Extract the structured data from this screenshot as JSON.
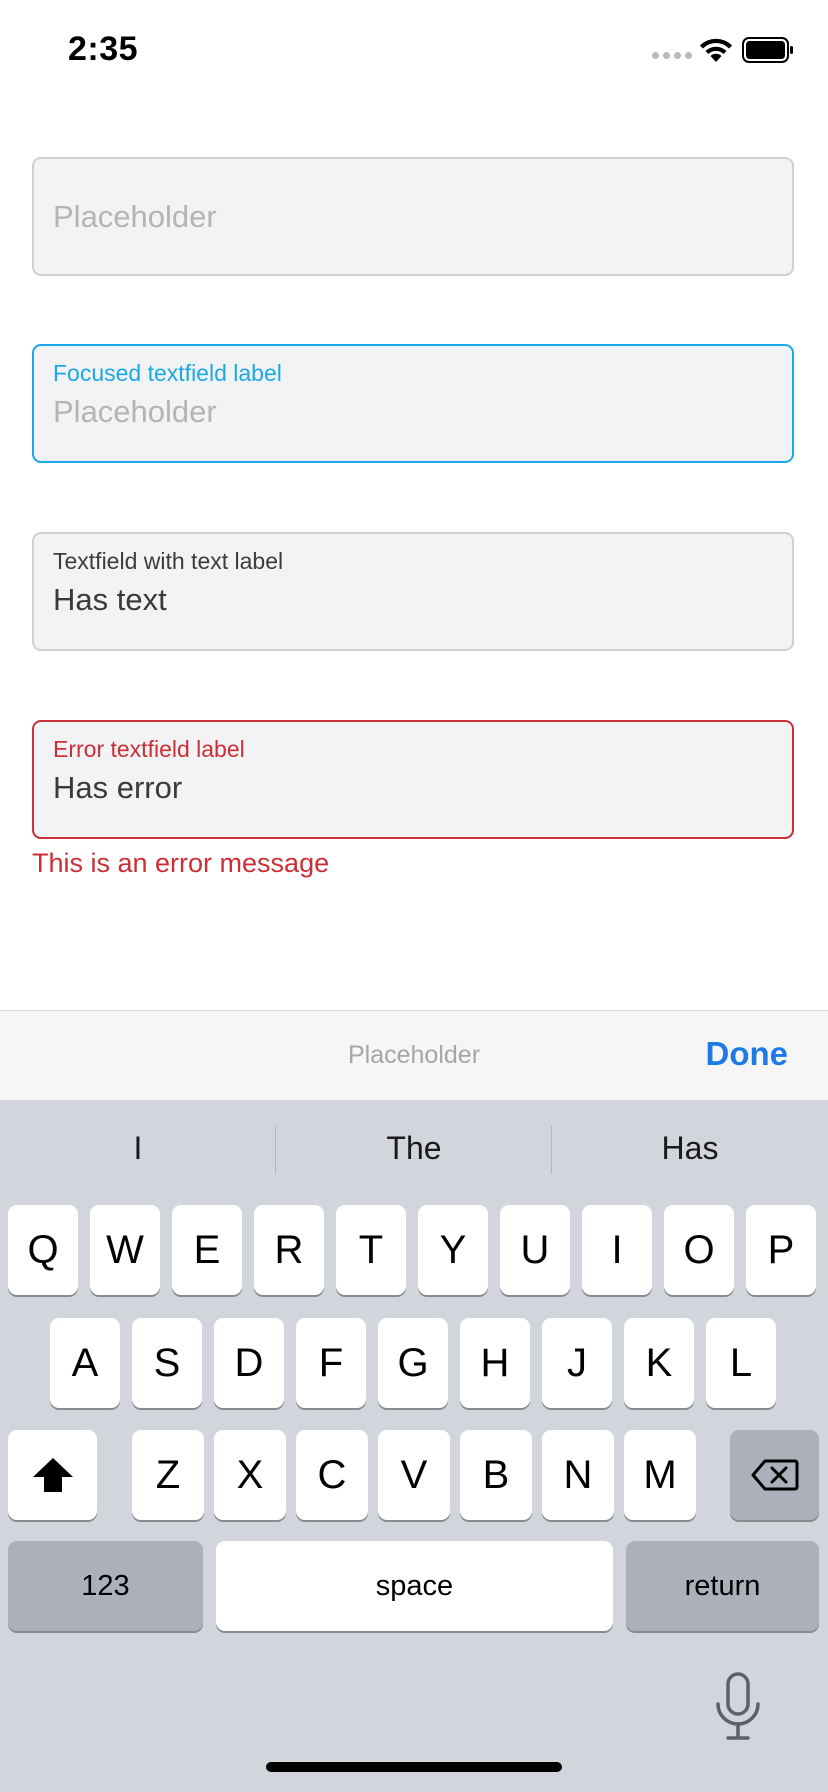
{
  "status_bar": {
    "time": "2:35"
  },
  "fields": [
    {
      "placeholder": "Placeholder"
    },
    {
      "label": "Focused textfield label",
      "placeholder": "Placeholder"
    },
    {
      "label": "Textfield with text label",
      "value": "Has text"
    },
    {
      "label": "Error textfield label",
      "value": "Has error",
      "error": "This is an error message"
    }
  ],
  "accessory": {
    "placeholder": "Placeholder",
    "done_label": "Done"
  },
  "keyboard": {
    "suggestions": [
      "I",
      "The",
      "Has"
    ],
    "row1": [
      "Q",
      "W",
      "E",
      "R",
      "T",
      "Y",
      "U",
      "I",
      "O",
      "P"
    ],
    "row2": [
      "A",
      "S",
      "D",
      "F",
      "G",
      "H",
      "J",
      "K",
      "L"
    ],
    "row3": [
      "Z",
      "X",
      "C",
      "V",
      "B",
      "N",
      "M"
    ],
    "numbers_label": "123",
    "space_label": "space",
    "return_label": "return"
  },
  "colors": {
    "focus": "#1ba8e8",
    "error": "#cc2f35",
    "done": "#1d7ae6",
    "keyboard_bg": "#d2d5db"
  },
  "icons": [
    "wifi-icon",
    "battery-icon",
    "shift-icon",
    "backspace-icon",
    "microphone-icon"
  ]
}
